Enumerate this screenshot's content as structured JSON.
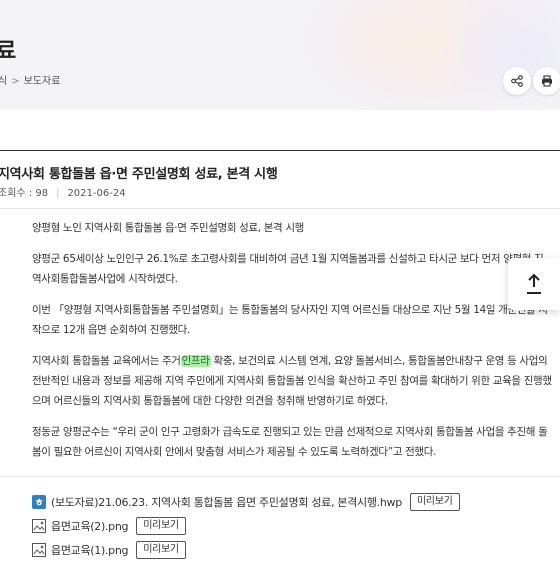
{
  "header": {
    "title_fragment": "료",
    "breadcrumb": {
      "prev": "식",
      "separator": ">",
      "current": "보도자료"
    }
  },
  "actions": {
    "share_icon": "share-icon",
    "print_icon": "print-icon"
  },
  "post": {
    "title": "지역사회 통합돌봄 읍·면 주민설명회 성료, 본격 시행",
    "views_label": "조회수 : 98",
    "date": "2021-06-24"
  },
  "content": {
    "p1": "양평형 노인 지역사회 통합돌봄 읍·면 주민설명회 성료, 본격 시행",
    "p2": "양평군 65세이상 노인인구 26.1%로 초고령사회를 대비하여 금년 1월 지역돌봄과를 신설하고 타시군 보다 먼저 양평형 지역사회통합돌봄사업에 시작하였다.",
    "p3": "이번 「양평형 지역사회통합돌봄 주민설명회」는 통합돌봄의 당사자인 지역 어르신들 대상으로 지난 5월 14일 개군면을 시작으로 12개 읍면 순회하여 진행했다.",
    "p4_a": "지역사회 통합돌봄 교육에서는 주거",
    "p4_hl": "인프라",
    "p4_b": " 확충, 보건의료 시스템 연계, 요양 돌봄서비스, 통합돌봄안내창구 운영 등 사업의 전반적인 내용과 정보를 제공해 지역 주민에게 지역사회 통합돌봄 인식을 확산하고 주민 참여를 확대하기 위한 교육을 진행했으며 어르신들의 지역사회 통합돌봄에 대한 다양한 의견을 청취해 반영하기로 하였다.",
    "p5": "정동균 양평군수는 “우리 군이 인구 고령화가 급속도로 진행되고 있는 만큼 선제적으로 지역사회 통합돌봄 사업을 추진해 돌봄이 필요한 어르신이 지역사회 안에서 맞춤형 서비스가 제공될 수 있도록 노력하겠다”고 전했다."
  },
  "attachments": [
    {
      "name": "(보도자료)21.06.23. 지역사회 통합돌봄 읍면 주민설명회 성료, 본격시행.hwp",
      "icon": "hwp-file-icon",
      "preview": "미리보기"
    },
    {
      "name": "읍면교육(2).png",
      "icon": "image-file-icon",
      "preview": "미리보기"
    },
    {
      "name": "읍면교육(1).png",
      "icon": "image-file-icon",
      "preview": "미리보기"
    }
  ],
  "colors": {
    "accent_hwp": "#2f7fc1",
    "highlight": "#a8f0a8"
  }
}
